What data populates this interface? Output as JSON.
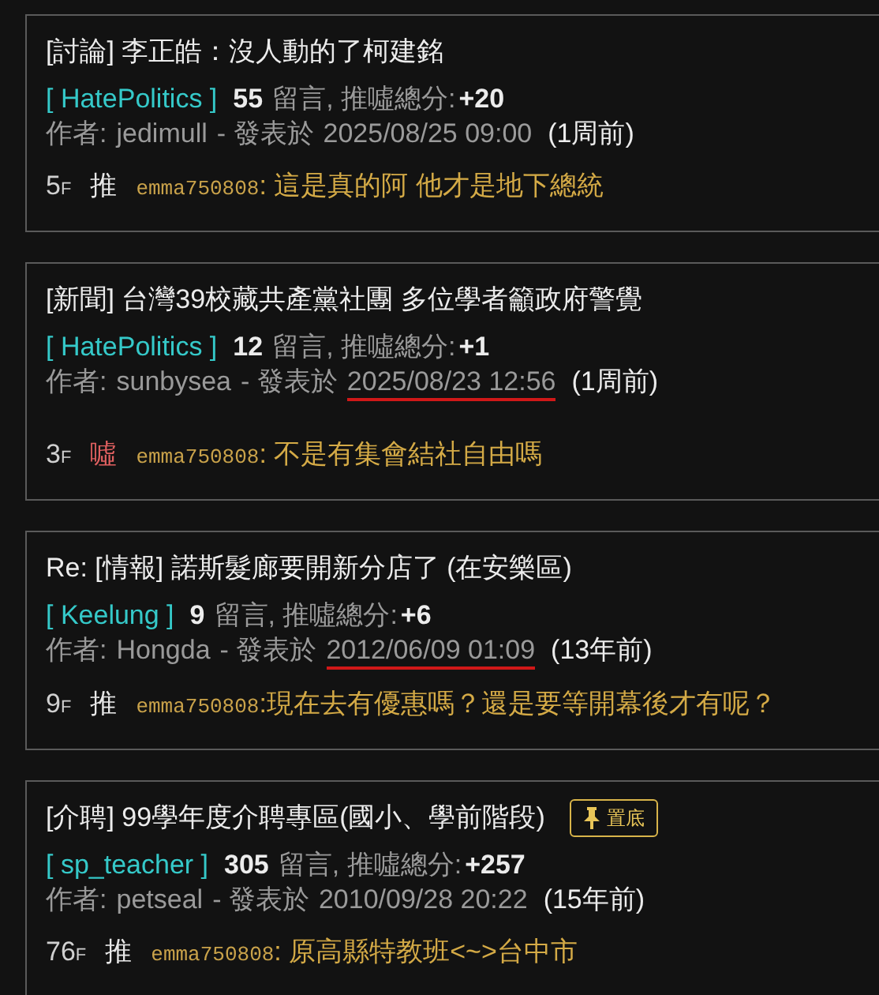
{
  "posts": [
    {
      "title": "[討論] 李正皓：沒人動的了柯建銘",
      "board": "[ HatePolitics ]",
      "comment_count": "55",
      "comments_label": "留言, 推噓總分:",
      "score": "+20",
      "author_label": "作者:",
      "author": "jedimull",
      "posted_label": "- 發表於",
      "date": "2025/08/25 09:00",
      "date_underlined": false,
      "age": "(1周前)",
      "comment": {
        "floor": "5",
        "floor_unit": "F",
        "kind": "push",
        "tag": "推",
        "user": "emma750808",
        "text": ": 這是真的阿 他才是地下總統"
      }
    },
    {
      "title": "[新聞] 台灣39校藏共產黨社團 多位學者籲政府警覺",
      "board": "[ HatePolitics ]",
      "comment_count": "12",
      "comments_label": "留言, 推噓總分:",
      "score": "+1",
      "author_label": "作者:",
      "author": "sunbysea",
      "posted_label": "- 發表於",
      "date": "2025/08/23 12:56",
      "date_underlined": true,
      "age": "(1周前)",
      "comment": {
        "floor": "3",
        "floor_unit": "F",
        "kind": "boo",
        "tag": "噓",
        "user": "emma750808",
        "text": ": 不是有集會結社自由嗎"
      }
    },
    {
      "title": "Re: [情報] 諾斯髮廊要開新分店了 (在安樂區)",
      "board": "[ Keelung ]",
      "comment_count": "9",
      "comments_label": "留言, 推噓總分:",
      "score": "+6",
      "author_label": "作者:",
      "author": "Hongda",
      "posted_label": "- 發表於",
      "date": "2012/06/09 01:09",
      "date_underlined": true,
      "age": "(13年前)",
      "comment": {
        "floor": "9",
        "floor_unit": "F",
        "kind": "push",
        "tag": "推",
        "user": "emma750808",
        "text": ":現在去有優惠嗎？還是要等開幕後才有呢？"
      }
    },
    {
      "title": "[介聘] 99學年度介聘專區(國小、學前階段)",
      "pinned_label": "置底",
      "board": "[ sp_teacher ]",
      "comment_count": "305",
      "comments_label": "留言, 推噓總分:",
      "score": "+257",
      "author_label": "作者:",
      "author": "petseal",
      "posted_label": "- 發表於",
      "date": "2010/09/28 20:22",
      "date_underlined": false,
      "age": "(15年前)",
      "comment": {
        "floor": "76",
        "floor_unit": "F",
        "kind": "push",
        "tag": "推",
        "user": "emma750808",
        "text": ": 原高縣特教班<~>台中市"
      }
    }
  ]
}
